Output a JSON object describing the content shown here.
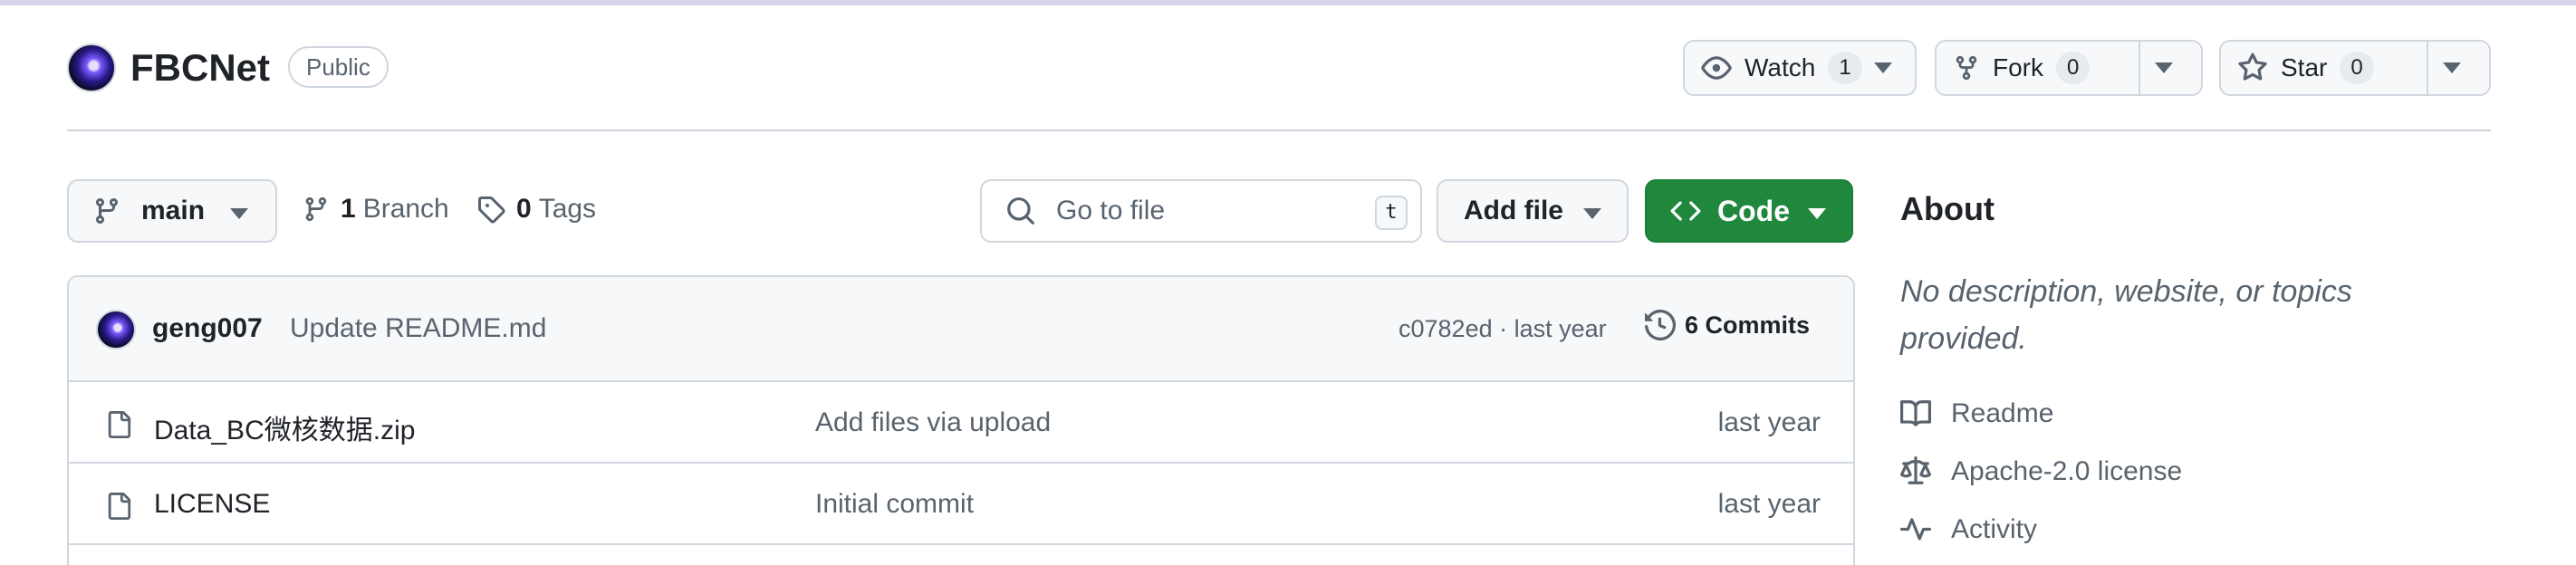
{
  "repo": {
    "name": "FBCNet",
    "visibility": "Public"
  },
  "actions": {
    "watch": {
      "label": "Watch",
      "count": "1"
    },
    "fork": {
      "label": "Fork",
      "count": "0"
    },
    "star": {
      "label": "Star",
      "count": "0"
    }
  },
  "toolbar": {
    "branch": "main",
    "branches_count": "1",
    "branches_label": "Branch",
    "tags_count": "0",
    "tags_label": "Tags",
    "search_placeholder": "Go to file",
    "search_shortcut": "t",
    "add_file": "Add file",
    "code": "Code"
  },
  "latest_commit": {
    "author": "geng007",
    "message": "Update README.md",
    "hash_time": "c0782ed · last year",
    "commits_label": "6 Commits"
  },
  "files": [
    {
      "name": "Data_BC微核数据.zip",
      "commit": "Add files via upload",
      "date": "last year",
      "icon": "file-icon"
    },
    {
      "name": "LICENSE",
      "commit": "Initial commit",
      "date": "last year",
      "icon": "file-icon"
    }
  ],
  "about": {
    "title": "About",
    "description": "No description, website, or topics provided.",
    "readme": "Readme",
    "license": "Apache-2.0 license",
    "activity": "Activity"
  },
  "colors": {
    "code_button": "#1f883d",
    "border": "#d0d7de",
    "muted_text": "#59636e"
  }
}
